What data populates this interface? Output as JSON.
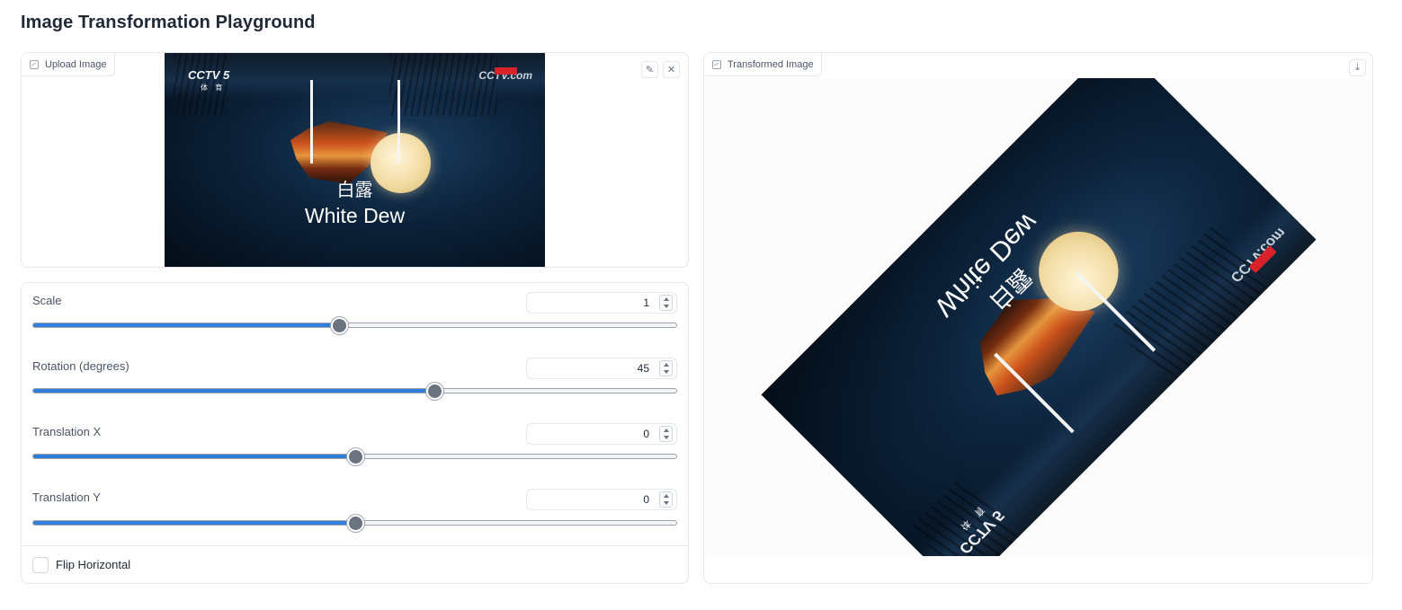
{
  "page": {
    "title": "Image Transformation Playground"
  },
  "upload": {
    "label": "Upload Image",
    "label_icon": "image-icon",
    "actions": {
      "edit_icon": "pencil-icon",
      "edit_glyph": "✎",
      "clear_icon": "close-icon",
      "clear_glyph": "✕"
    }
  },
  "image": {
    "logo_left": "CCTV 5",
    "logo_left_sub": "体 育",
    "logo_right": "CCTV.com",
    "caption_cn": "白露",
    "caption_en": "White Dew"
  },
  "output": {
    "label": "Transformed Image",
    "label_icon": "image-icon",
    "download_icon": "download-icon",
    "download_glyph": "⤓"
  },
  "controls": {
    "scale": {
      "label": "Scale",
      "value": "1",
      "fraction": 0.475
    },
    "rotation": {
      "label": "Rotation (degrees)",
      "value": "45",
      "fraction": 0.623
    },
    "translate_x": {
      "label": "Translation X",
      "value": "0",
      "fraction": 0.5
    },
    "translate_y": {
      "label": "Translation Y",
      "value": "0",
      "fraction": 0.5
    },
    "flip": {
      "label": "Flip Horizontal",
      "checked": false
    }
  },
  "colors": {
    "accent": "#2f7ed8",
    "thumb": "#6b7280",
    "border": "#e5e7eb"
  }
}
